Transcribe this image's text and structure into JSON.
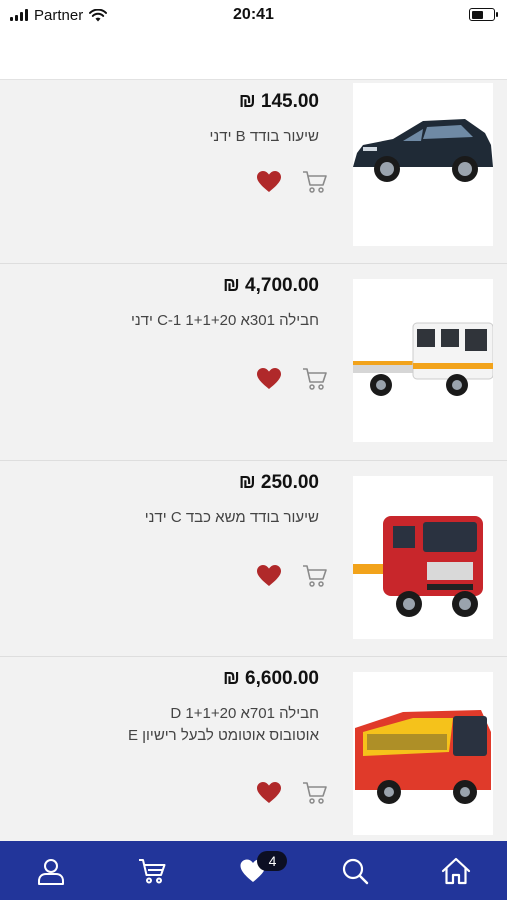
{
  "status_bar": {
    "carrier": "Partner",
    "time": "20:41",
    "battery_level": 0.55
  },
  "products": [
    {
      "price": "₪ 145.00",
      "name_lines": [
        "שיעור בודד B ידני"
      ],
      "image": "car-icon"
    },
    {
      "price": "₪ 4,700.00",
      "name_lines": [
        "חבילה 301א 1+1+20 C-1 ידני"
      ],
      "image": "tow-truck-icon"
    },
    {
      "price": "₪ 250.00",
      "name_lines": [
        "שיעור בודד משא כבד C ידני"
      ],
      "image": "heavy-truck-icon"
    },
    {
      "price": "₪ 6,600.00",
      "name_lines": [
        "חבילה 701א 1+1+20 D",
        "אוטובוס אוטומט לבעל רישיון E"
      ],
      "image": "bus-icon"
    }
  ],
  "bottom_nav": {
    "items": [
      "home-icon",
      "search-icon",
      "favorites-icon",
      "cart-icon",
      "profile-icon"
    ],
    "favorites_badge": "4"
  },
  "colors": {
    "nav_bg": "#22359a",
    "heart": "#b0292a",
    "badge_bg": "#0c0f23"
  }
}
